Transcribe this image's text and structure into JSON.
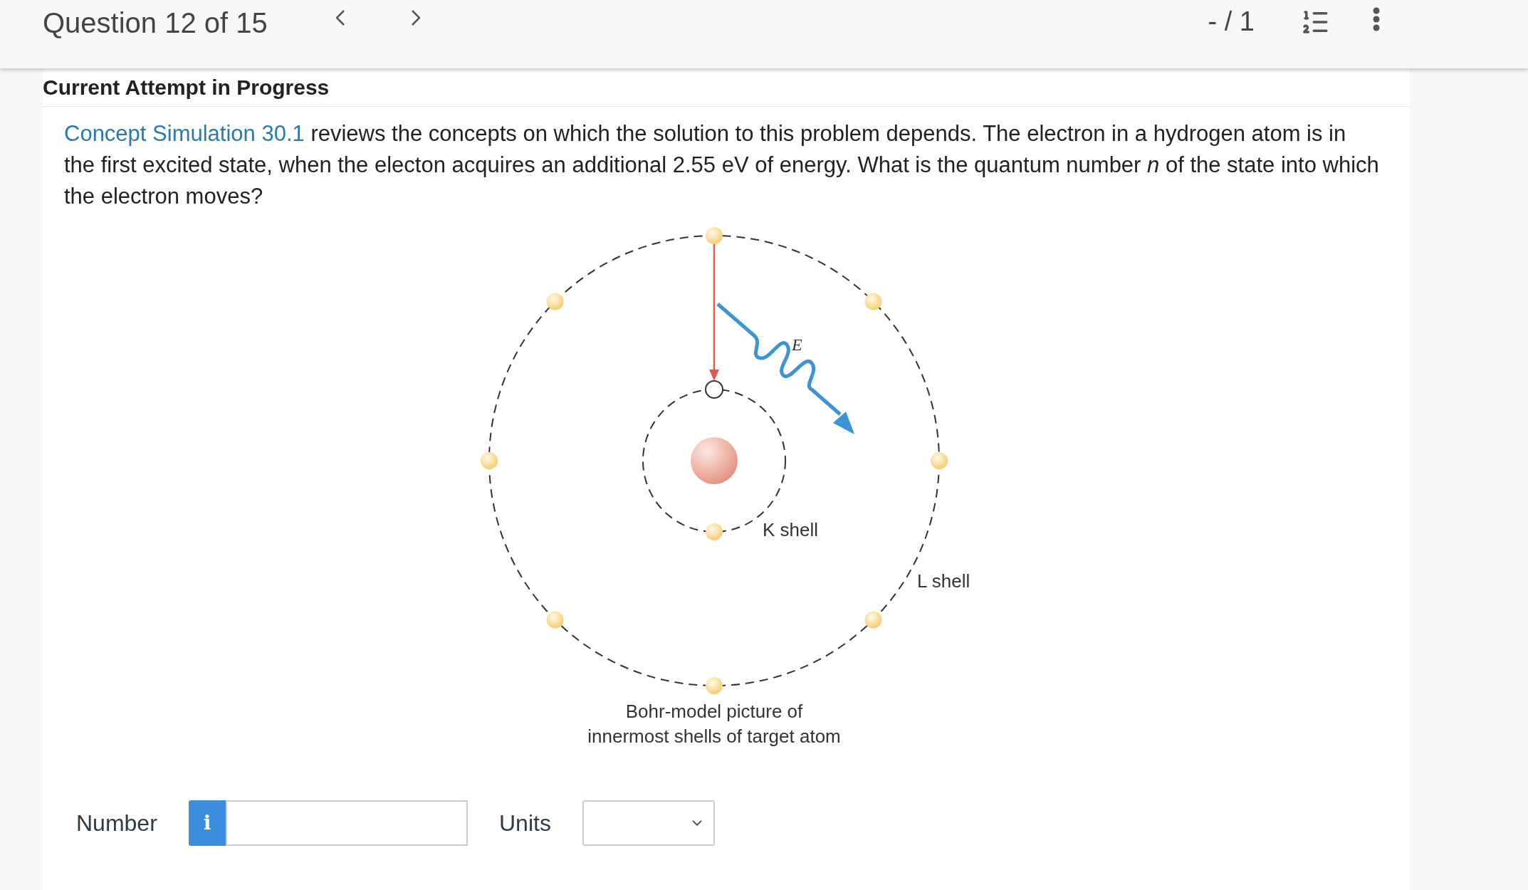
{
  "header": {
    "title": "Question 12 of 15",
    "score": "- / 1"
  },
  "section_title": "Current Attempt in Progress",
  "question": {
    "link": "Concept Simulation 30.1",
    "text": " reviews the concepts on which the solution to this problem depends. The electron in a hydrogen atom is in the first excited state, when the electon acquires an additional 2.55 eV of energy. What is the quantum number *n* of the state into which the electron moves?"
  },
  "figure": {
    "energy_label": "E",
    "inner_label": "K shell",
    "outer_label": "L shell",
    "caption": [
      "Bohr-model picture of",
      "innermost shells of target atom"
    ]
  },
  "answer": {
    "number_label": "Number",
    "info_icon": "i",
    "units_label": "Units"
  }
}
